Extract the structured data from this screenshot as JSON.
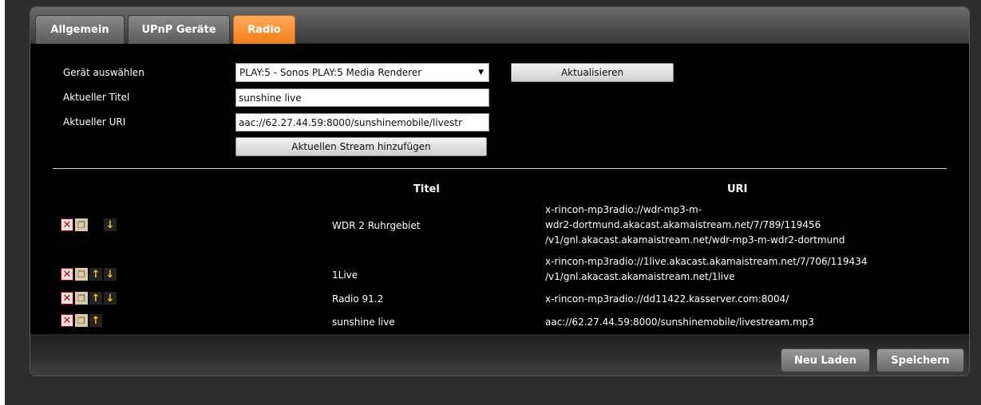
{
  "tabs": [
    {
      "label": "Allgemein"
    },
    {
      "label": "UPnP Geräte"
    },
    {
      "label": "Radio"
    }
  ],
  "active_tab": "Radio",
  "form": {
    "device_label": "Gerät auswählen",
    "device_value": "PLAY:5 - Sonos PLAY:5 Media Renderer",
    "refresh_button": "Aktualisieren",
    "title_label": "Aktueller Titel",
    "title_value": "sunshine live",
    "uri_label": "Aktueller URI",
    "uri_value": "aac://62.27.44.59:8000/sunshinemobile/livestr",
    "add_button": "Aktuellen Stream hinzufügen"
  },
  "table": {
    "headers": {
      "title": "Titel",
      "uri": "URI"
    },
    "rows": [
      {
        "title": "WDR 2 Ruhrgebiet",
        "uri_lines": [
          "x-rincon-mp3radio://wdr-mp3-m-",
          "wdr2-dortmund.akacast.akamaistream.net/7/789/119456",
          "/v1/gnl.akacast.akamaistream.net/wdr-mp3-m-wdr2-dortmund"
        ],
        "icons": [
          "delete-icon",
          "copy-icon",
          "spacer",
          "move-down-icon"
        ]
      },
      {
        "title": "1Live",
        "uri_lines": [
          "x-rincon-mp3radio://1live.akacast.akamaistream.net/7/706/119434",
          "/v1/gnl.akacast.akamaistream.net/1live"
        ],
        "icons": [
          "delete-icon",
          "copy-icon",
          "move-up-icon",
          "move-down-icon"
        ]
      },
      {
        "title": "Radio 91.2",
        "uri_lines": [
          "x-rincon-mp3radio://dd11422.kasserver.com:8004/"
        ],
        "icons": [
          "delete-icon",
          "copy-icon",
          "move-up-icon",
          "move-down-icon"
        ]
      },
      {
        "title": "sunshine live",
        "uri_lines": [
          "aac://62.27.44.59:8000/sunshinemobile/livestream.mp3"
        ],
        "icons": [
          "delete-icon",
          "copy-icon",
          "move-up-icon"
        ]
      }
    ]
  },
  "footer": {
    "reload_button": "Neu Laden",
    "save_button": "Speichern"
  },
  "colors": {
    "active_tab": "#f08a24",
    "delete": "#d00000",
    "arrow": "#f3c21a"
  }
}
